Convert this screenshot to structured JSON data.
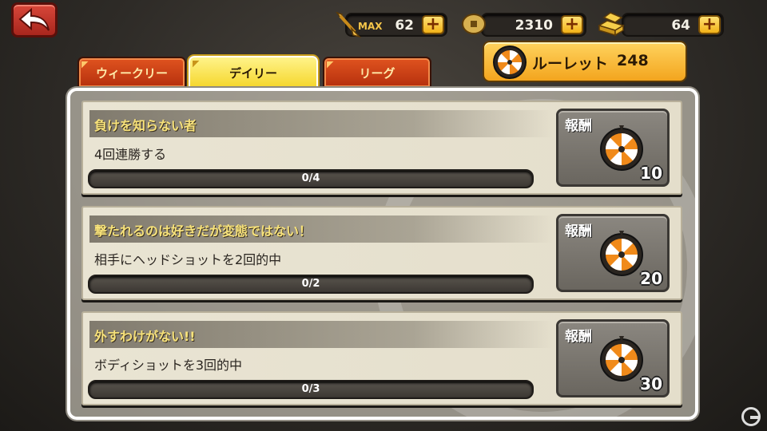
{
  "header": {
    "back_icon": "back-arrow-icon",
    "resources": [
      {
        "id": "stamina",
        "icon": "arrow-icon",
        "prefix": "MAX",
        "value": "62",
        "plus": "+"
      },
      {
        "id": "coins",
        "icon": "coin-icon",
        "value": "2310",
        "plus": "+"
      },
      {
        "id": "gold",
        "icon": "gold-bars-icon",
        "value": "64",
        "plus": "+"
      }
    ]
  },
  "roulette": {
    "label": "ルーレット",
    "count": "248",
    "icon": "roulette-wheel-icon"
  },
  "tabs": [
    {
      "label": "ウィークリー",
      "active": false
    },
    {
      "label": "デイリー",
      "active": true
    },
    {
      "label": "リーグ",
      "active": false
    }
  ],
  "missions": [
    {
      "title": "負けを知らない者",
      "description": "4回連勝する",
      "progress_text": "0/4",
      "progress": 0,
      "reward_label": "報酬",
      "reward_amount": "10"
    },
    {
      "title": "撃たれるのは好きだが変態ではない！",
      "description": "相手にヘッドショットを2回的中",
      "progress_text": "0/2",
      "progress": 0,
      "reward_label": "報酬",
      "reward_amount": "20"
    },
    {
      "title": "外すわけがない!!",
      "description": "ボディショットを3回的中",
      "progress_text": "0/3",
      "progress": 0,
      "reward_label": "報酬",
      "reward_amount": "30"
    }
  ],
  "colors": {
    "accent_gold": "#f3a51e",
    "tab_red": "#c23a14",
    "tab_active": "#f5d62a"
  }
}
